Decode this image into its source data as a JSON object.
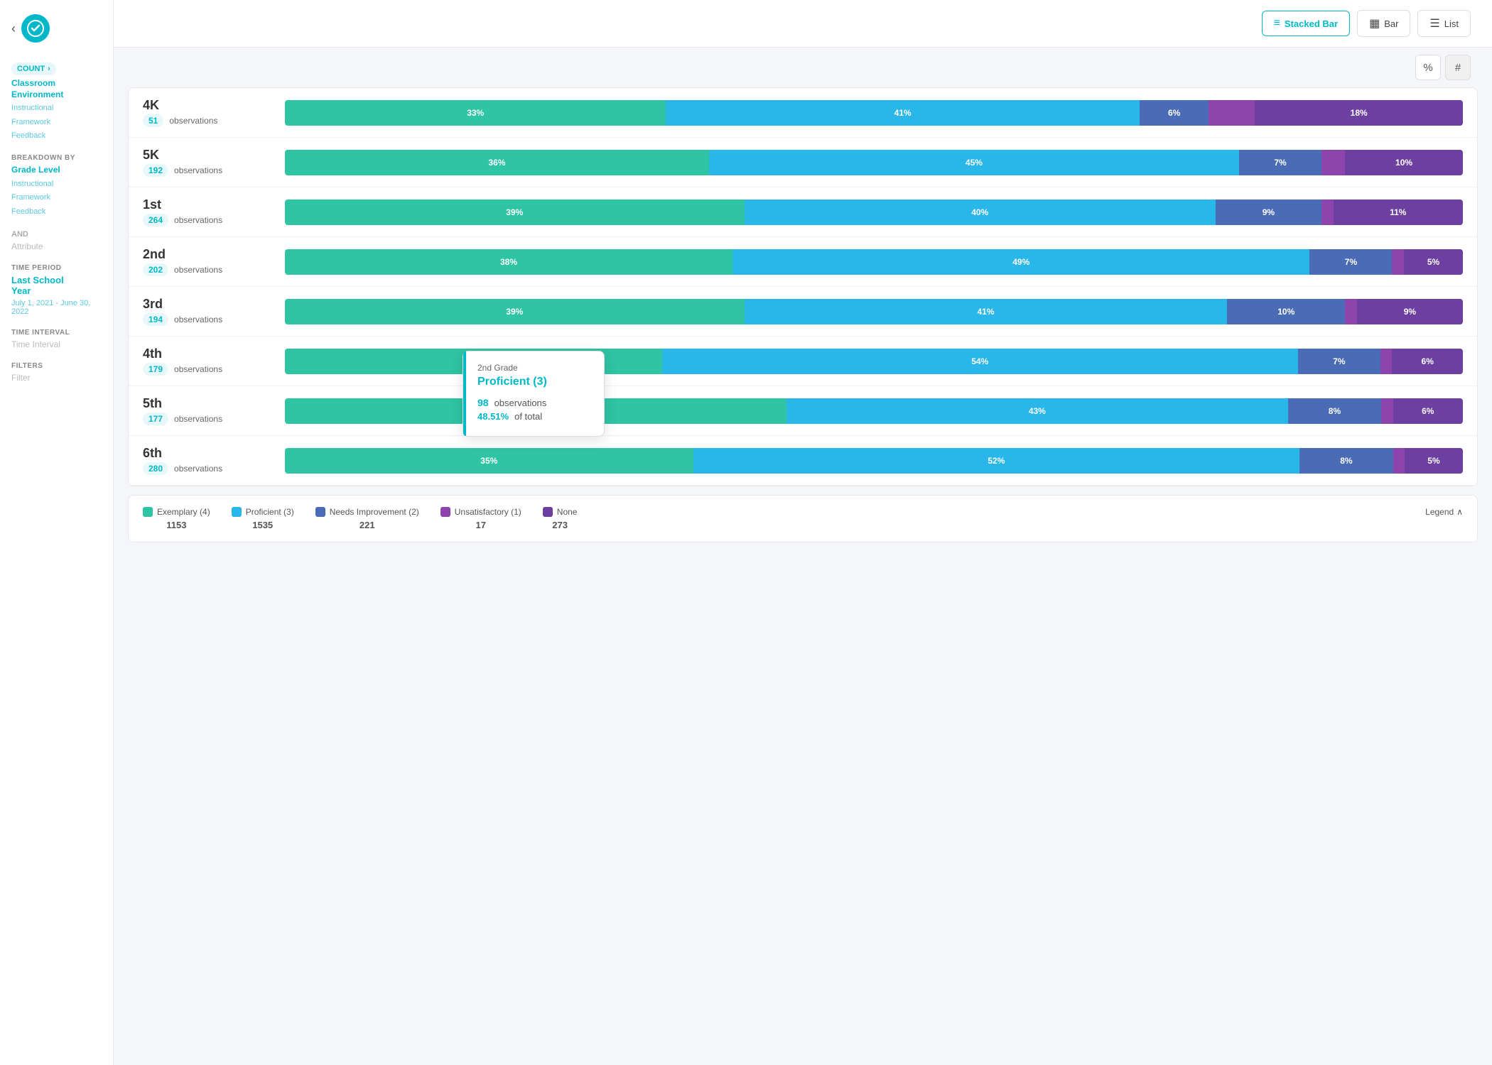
{
  "app": {
    "logo_symbol": "✓"
  },
  "sidebar": {
    "count_label": "COUNT",
    "count_arrow": "›",
    "section_measure": {
      "link": "Classroom Environment",
      "sublinks": [
        "Instructional",
        "Framework",
        "Feedback"
      ]
    },
    "breakdown_label": "BREAKDOWN BY",
    "breakdown_value": "Grade Level",
    "breakdown_sublinks": [
      "Instructional",
      "Framework",
      "Feedback"
    ],
    "and_label": "AND",
    "attribute_label": "Attribute",
    "time_period_label": "TIME PERIOD",
    "time_period_value": "Last School Year",
    "time_period_date": "July 1, 2021 - June 30, 2022",
    "time_interval_label": "TIME INTERVAL",
    "time_interval_value": "Time Interval",
    "filters_label": "FILTERS",
    "filter_value": "Filter"
  },
  "topbar": {
    "stacked_bar_label": "Stacked Bar",
    "bar_label": "Bar",
    "list_label": "List"
  },
  "controls": {
    "percent_label": "%",
    "hash_label": "#"
  },
  "chart": {
    "rows": [
      {
        "grade": "4K",
        "obs_count": "51",
        "obs_label": "observations",
        "segments": [
          {
            "color": "#2ec4a4",
            "pct": 33,
            "label": "33%"
          },
          {
            "color": "#29b6e8",
            "pct": 41,
            "label": "41%"
          },
          {
            "color": "#4a6bb5",
            "pct": 6,
            "label": "6%"
          },
          {
            "color": "#8e44ad",
            "pct": 4,
            "label": ""
          },
          {
            "color": "#6c3fa0",
            "pct": 18,
            "label": "18%"
          }
        ]
      },
      {
        "grade": "5K",
        "obs_count": "192",
        "obs_label": "observations",
        "segments": [
          {
            "color": "#2ec4a4",
            "pct": 36,
            "label": "36%"
          },
          {
            "color": "#29b6e8",
            "pct": 45,
            "label": "45%"
          },
          {
            "color": "#4a6bb5",
            "pct": 7,
            "label": "7%"
          },
          {
            "color": "#8e44ad",
            "pct": 2,
            "label": ""
          },
          {
            "color": "#6c3fa0",
            "pct": 10,
            "label": "10%"
          }
        ]
      },
      {
        "grade": "1st",
        "obs_count": "264",
        "obs_label": "observations",
        "segments": [
          {
            "color": "#2ec4a4",
            "pct": 39,
            "label": "39%"
          },
          {
            "color": "#29b6e8",
            "pct": 40,
            "label": "40%"
          },
          {
            "color": "#4a6bb5",
            "pct": 9,
            "label": "9%"
          },
          {
            "color": "#8e44ad",
            "pct": 1,
            "label": ""
          },
          {
            "color": "#6c3fa0",
            "pct": 11,
            "label": "11%"
          }
        ]
      },
      {
        "grade": "2nd",
        "obs_count": "202",
        "obs_label": "observations",
        "segments": [
          {
            "color": "#2ec4a4",
            "pct": 38,
            "label": "38%"
          },
          {
            "color": "#29b6e8",
            "pct": 49,
            "label": "49%"
          },
          {
            "color": "#4a6bb5",
            "pct": 7,
            "label": "7%"
          },
          {
            "color": "#8e44ad",
            "pct": 1,
            "label": ""
          },
          {
            "color": "#6c3fa0",
            "pct": 5,
            "label": "5%"
          }
        ]
      },
      {
        "grade": "3rd",
        "obs_count": "194",
        "obs_label": "observations",
        "segments": [
          {
            "color": "#2ec4a4",
            "pct": 39,
            "label": "39%"
          },
          {
            "color": "#29b6e8",
            "pct": 41,
            "label": "41%"
          },
          {
            "color": "#4a6bb5",
            "pct": 10,
            "label": "10%"
          },
          {
            "color": "#8e44ad",
            "pct": 1,
            "label": ""
          },
          {
            "color": "#6c3fa0",
            "pct": 9,
            "label": "9%"
          }
        ]
      },
      {
        "grade": "4th",
        "obs_count": "179",
        "obs_label": "observations",
        "segments": [
          {
            "color": "#2ec4a4",
            "pct": 32,
            "label": "32%"
          },
          {
            "color": "#29b6e8",
            "pct": 54,
            "label": "54%"
          },
          {
            "color": "#4a6bb5",
            "pct": 7,
            "label": "7%"
          },
          {
            "color": "#8e44ad",
            "pct": 1,
            "label": ""
          },
          {
            "color": "#6c3fa0",
            "pct": 6,
            "label": "6%"
          }
        ]
      },
      {
        "grade": "5th",
        "obs_count": "177",
        "obs_label": "observations",
        "segments": [
          {
            "color": "#2ec4a4",
            "pct": 43,
            "label": "43%"
          },
          {
            "color": "#29b6e8",
            "pct": 43,
            "label": "43%"
          },
          {
            "color": "#4a6bb5",
            "pct": 8,
            "label": "8%"
          },
          {
            "color": "#8e44ad",
            "pct": 1,
            "label": ""
          },
          {
            "color": "#6c3fa0",
            "pct": 6,
            "label": "6%"
          }
        ]
      },
      {
        "grade": "6th",
        "obs_count": "280",
        "obs_label": "observations",
        "segments": [
          {
            "color": "#2ec4a4",
            "pct": 35,
            "label": "35%"
          },
          {
            "color": "#29b6e8",
            "pct": 52,
            "label": "52%"
          },
          {
            "color": "#4a6bb5",
            "pct": 8,
            "label": "8%"
          },
          {
            "color": "#8e44ad",
            "pct": 1,
            "label": ""
          },
          {
            "color": "#6c3fa0",
            "pct": 5,
            "label": "5%"
          }
        ]
      }
    ]
  },
  "tooltip": {
    "grade": "2nd Grade",
    "title": "Proficient (3)",
    "count": "98",
    "obs_label": "observations",
    "pct": "48.51%",
    "of_label": "of total"
  },
  "legend": {
    "toggle_label": "Legend",
    "items": [
      {
        "label": "Exemplary (4)",
        "count": "1153",
        "color": "#2ec4a4"
      },
      {
        "label": "Proficient (3)",
        "count": "1535",
        "color": "#29b6e8"
      },
      {
        "label": "Needs Improvement (2)",
        "count": "221",
        "color": "#4a6bb5"
      },
      {
        "label": "Unsatisfactory (1)",
        "count": "17",
        "color": "#8e44ad"
      },
      {
        "label": "None",
        "count": "273",
        "color": "#6c3fa0"
      }
    ]
  }
}
